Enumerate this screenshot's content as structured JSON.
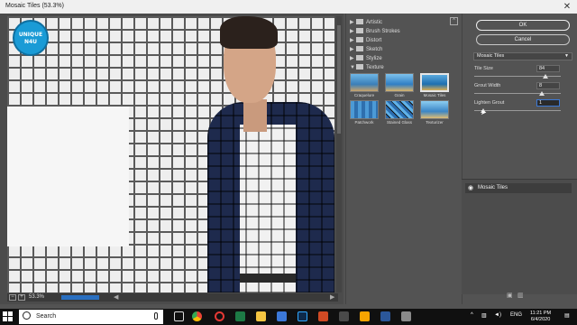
{
  "window": {
    "title": "Mosaic Tiles (53.3%)"
  },
  "watermark": {
    "line1": "UNIQUE",
    "line2": "N4U"
  },
  "preview": {
    "zoom": "53.3%"
  },
  "filters": {
    "folders": [
      {
        "label": "Artistic",
        "expanded": false
      },
      {
        "label": "Brush Strokes",
        "expanded": false
      },
      {
        "label": "Distort",
        "expanded": false
      },
      {
        "label": "Sketch",
        "expanded": false
      },
      {
        "label": "Stylize",
        "expanded": false
      },
      {
        "label": "Texture",
        "expanded": true
      }
    ],
    "textures": [
      {
        "label": "Craquelure",
        "selected": false
      },
      {
        "label": "Grain",
        "selected": false
      },
      {
        "label": "Mosaic Tiles",
        "selected": true
      },
      {
        "label": "Patchwork",
        "selected": false
      },
      {
        "label": "Stained Glass",
        "selected": false
      },
      {
        "label": "Texturizer",
        "selected": false
      }
    ]
  },
  "actions": {
    "ok": "OK",
    "cancel": "Cancel"
  },
  "settings": {
    "filter_select": "Mosaic Tiles",
    "params": [
      {
        "label": "Tile Size",
        "value": "84",
        "fraction": 0.82,
        "active": false
      },
      {
        "label": "Grout Width",
        "value": "8",
        "fraction": 0.78,
        "active": false
      },
      {
        "label": "Lighten Grout",
        "value": "1",
        "fraction": 0.1,
        "active": true
      }
    ]
  },
  "layers": {
    "items": [
      {
        "label": "Mosaic Tiles"
      }
    ]
  },
  "taskbar": {
    "search_placeholder": "Search",
    "lang": "ENG",
    "time": "11:21 PM",
    "date": "6/4/2020"
  },
  "colors": {
    "accent": "#2a6fc0",
    "tile_grout": "#5a5a5a",
    "taskbar": "#101010"
  }
}
